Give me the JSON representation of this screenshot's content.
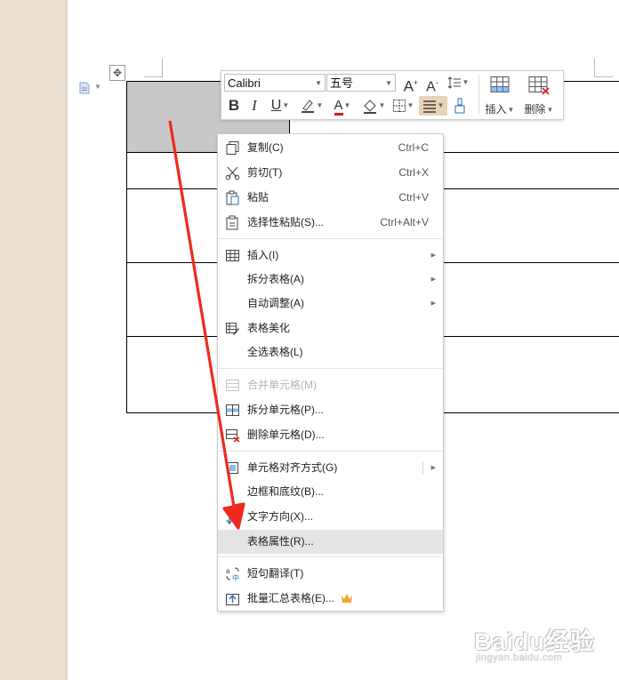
{
  "mini_toolbar": {
    "font_name": "Calibri",
    "font_size": "五号",
    "grow_font": "A",
    "shrink_font": "A",
    "bold": "B",
    "italic": "I",
    "underline": "U",
    "font_color_letter": "A",
    "insert_label": "插入",
    "delete_label": "删除",
    "accent_color": "#e8d3b7"
  },
  "context_menu": {
    "items": [
      {
        "label": "复制(C)",
        "shortcut": "Ctrl+C",
        "icon": "copy-icon"
      },
      {
        "label": "剪切(T)",
        "shortcut": "Ctrl+X",
        "icon": "scissors-icon"
      },
      {
        "label": "粘贴",
        "shortcut": "Ctrl+V",
        "icon": "paste-icon"
      },
      {
        "label": "选择性粘贴(S)...",
        "shortcut": "Ctrl+Alt+V",
        "icon": "paste-special-icon"
      },
      {
        "label": "插入(I)",
        "icon": "table-insert-icon",
        "submenu": true
      },
      {
        "label": "拆分表格(A)",
        "submenu": true
      },
      {
        "label": "自动调整(A)",
        "submenu": true
      },
      {
        "label": "表格美化",
        "icon": "table-beautify-icon"
      },
      {
        "label": "全选表格(L)"
      },
      {
        "label": "合并单元格(M)",
        "icon": "merge-cells-icon",
        "disabled": true
      },
      {
        "label": "拆分单元格(P)...",
        "icon": "split-cells-icon"
      },
      {
        "label": "删除单元格(D)...",
        "icon": "delete-cells-icon"
      },
      {
        "label": "单元格对齐方式(G)",
        "icon": "cell-align-icon",
        "submenu": true
      },
      {
        "label": "边框和底纹(B)..."
      },
      {
        "label": "文字方向(X)...",
        "icon": "text-direction-icon"
      },
      {
        "label": "表格属性(R)...",
        "highlighted": true
      },
      {
        "label": "短句翻译(T)",
        "icon": "translate-icon"
      },
      {
        "label": "批量汇总表格(E)...",
        "icon": "batch-summary-icon",
        "premium": true
      }
    ]
  },
  "annotation": {
    "arrow_color": "#ee2a1e"
  },
  "watermark": {
    "logo": "Baidu经验",
    "url": "jingyan.baidu.com"
  }
}
